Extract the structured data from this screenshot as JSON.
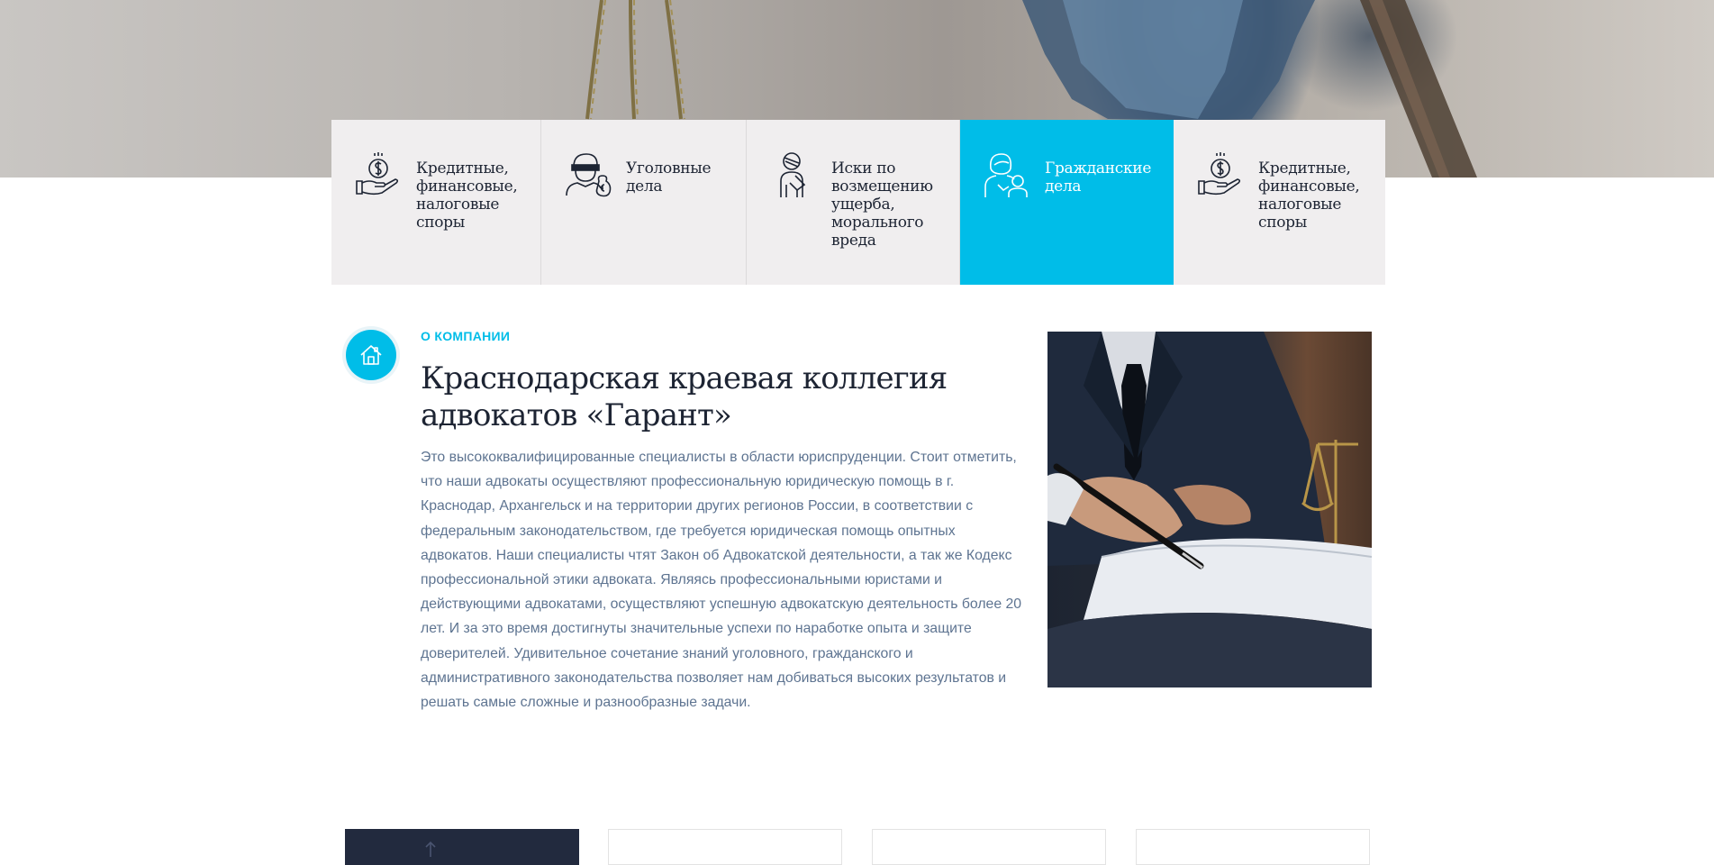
{
  "services": [
    {
      "label": "Кредитные,\nфинансовые,\nналоговые\nспоры",
      "icon": "money-hand-icon",
      "active": false
    },
    {
      "label": "Уголовные\nдела",
      "icon": "thief-icon",
      "active": false
    },
    {
      "label": "Иски по\nвозмещению\nущерба,\nморального\nвреда",
      "icon": "injured-person-icon",
      "active": false
    },
    {
      "label": "Гражданские\nдела",
      "icon": "family-icon",
      "active": true
    },
    {
      "label": "Кредитные,\nфинансовые,\nналоговые\nспоры",
      "icon": "money-hand-icon",
      "active": false
    }
  ],
  "about": {
    "eyebrow": "О КОМПАНИИ",
    "title": "Краснодарская краевая коллегия адвокатов «Гарант»",
    "description": "Это высококвалифицированные специалисты в области юриспруденции. Стоит отметить, что наши адвокаты осуществляют профессиональную юридическую помощь в г. Краснодар, Архангельск и на территории других регионов России, в соответствии с федеральным законодательством, где требуется юридическая помощь опытных адвокатов. Наши специалисты чтят Закон об Адвокатской деятельности, а так же Кодекс профессиональной этики адвоката. Являясь профессиональными юристами и действующими адвокатами, осуществляют успешную адвокатскую деятельность более 20 лет. И за это время достигнуты значительные успехи по наработке опыта и защите доверителей. Удивительное сочетание знаний уголовного, гражданского и административного законодательства позволяет нам добиваться высоких результатов и решать самые сложные и разнообразные задачи.",
    "icon": "home-icon"
  },
  "colors": {
    "accent": "#00bde8",
    "text_dark": "#1d2433",
    "text_body": "#5e7491",
    "tile_bg": "#f0eeef",
    "card_dark": "#222a3e"
  }
}
